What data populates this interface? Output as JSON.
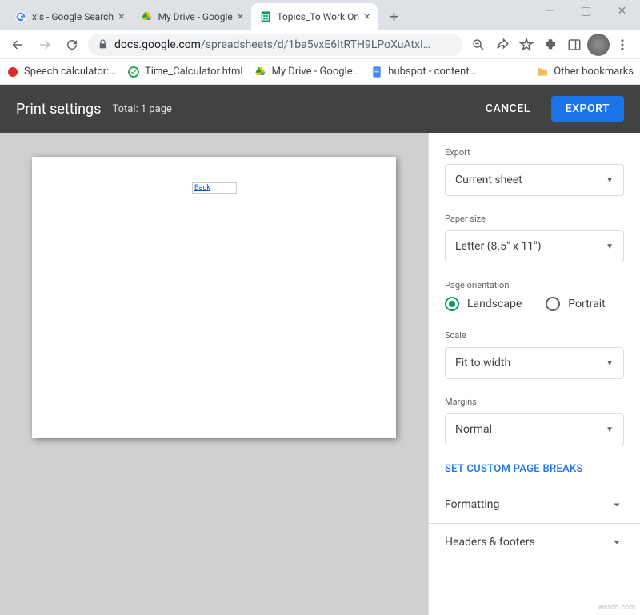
{
  "window": {
    "minimize": "—",
    "maximize": "▢",
    "close": "✕"
  },
  "tabs": [
    {
      "title": "xls - Google Search"
    },
    {
      "title": "My Drive - Google"
    },
    {
      "title": "Topics_To Work On"
    }
  ],
  "newtab": "+",
  "url": {
    "host": "docs.google.com",
    "path": "/spreadsheets/d/1ba5vxE6ItRTH9LPoXuAtxI…"
  },
  "bookmarks": [
    {
      "label": "Speech calculator:…"
    },
    {
      "label": "Time_Calculator.html"
    },
    {
      "label": "My Drive - Google…"
    },
    {
      "label": "hubspot - content…"
    }
  ],
  "otherBookmarks": "Other bookmarks",
  "ps": {
    "title": "Print settings",
    "totalPrefix": "Total: ",
    "totalValue": "1 page",
    "cancel": "CANCEL",
    "export": "EXPORT"
  },
  "preview": {
    "cellText": "Back"
  },
  "sidebar": {
    "exportLabel": "Export",
    "exportValue": "Current sheet",
    "paperLabel": "Paper size",
    "paperValue": "Letter (8.5\" x 11\")",
    "orientationLabel": "Page orientation",
    "landscape": "Landscape",
    "portrait": "Portrait",
    "scaleLabel": "Scale",
    "scaleValue": "Fit to width",
    "marginsLabel": "Margins",
    "marginsValue": "Normal",
    "customBreaks": "SET CUSTOM PAGE BREAKS",
    "formatting": "Formatting",
    "headersFooters": "Headers & footers"
  },
  "watermark": "wsxdn.com"
}
